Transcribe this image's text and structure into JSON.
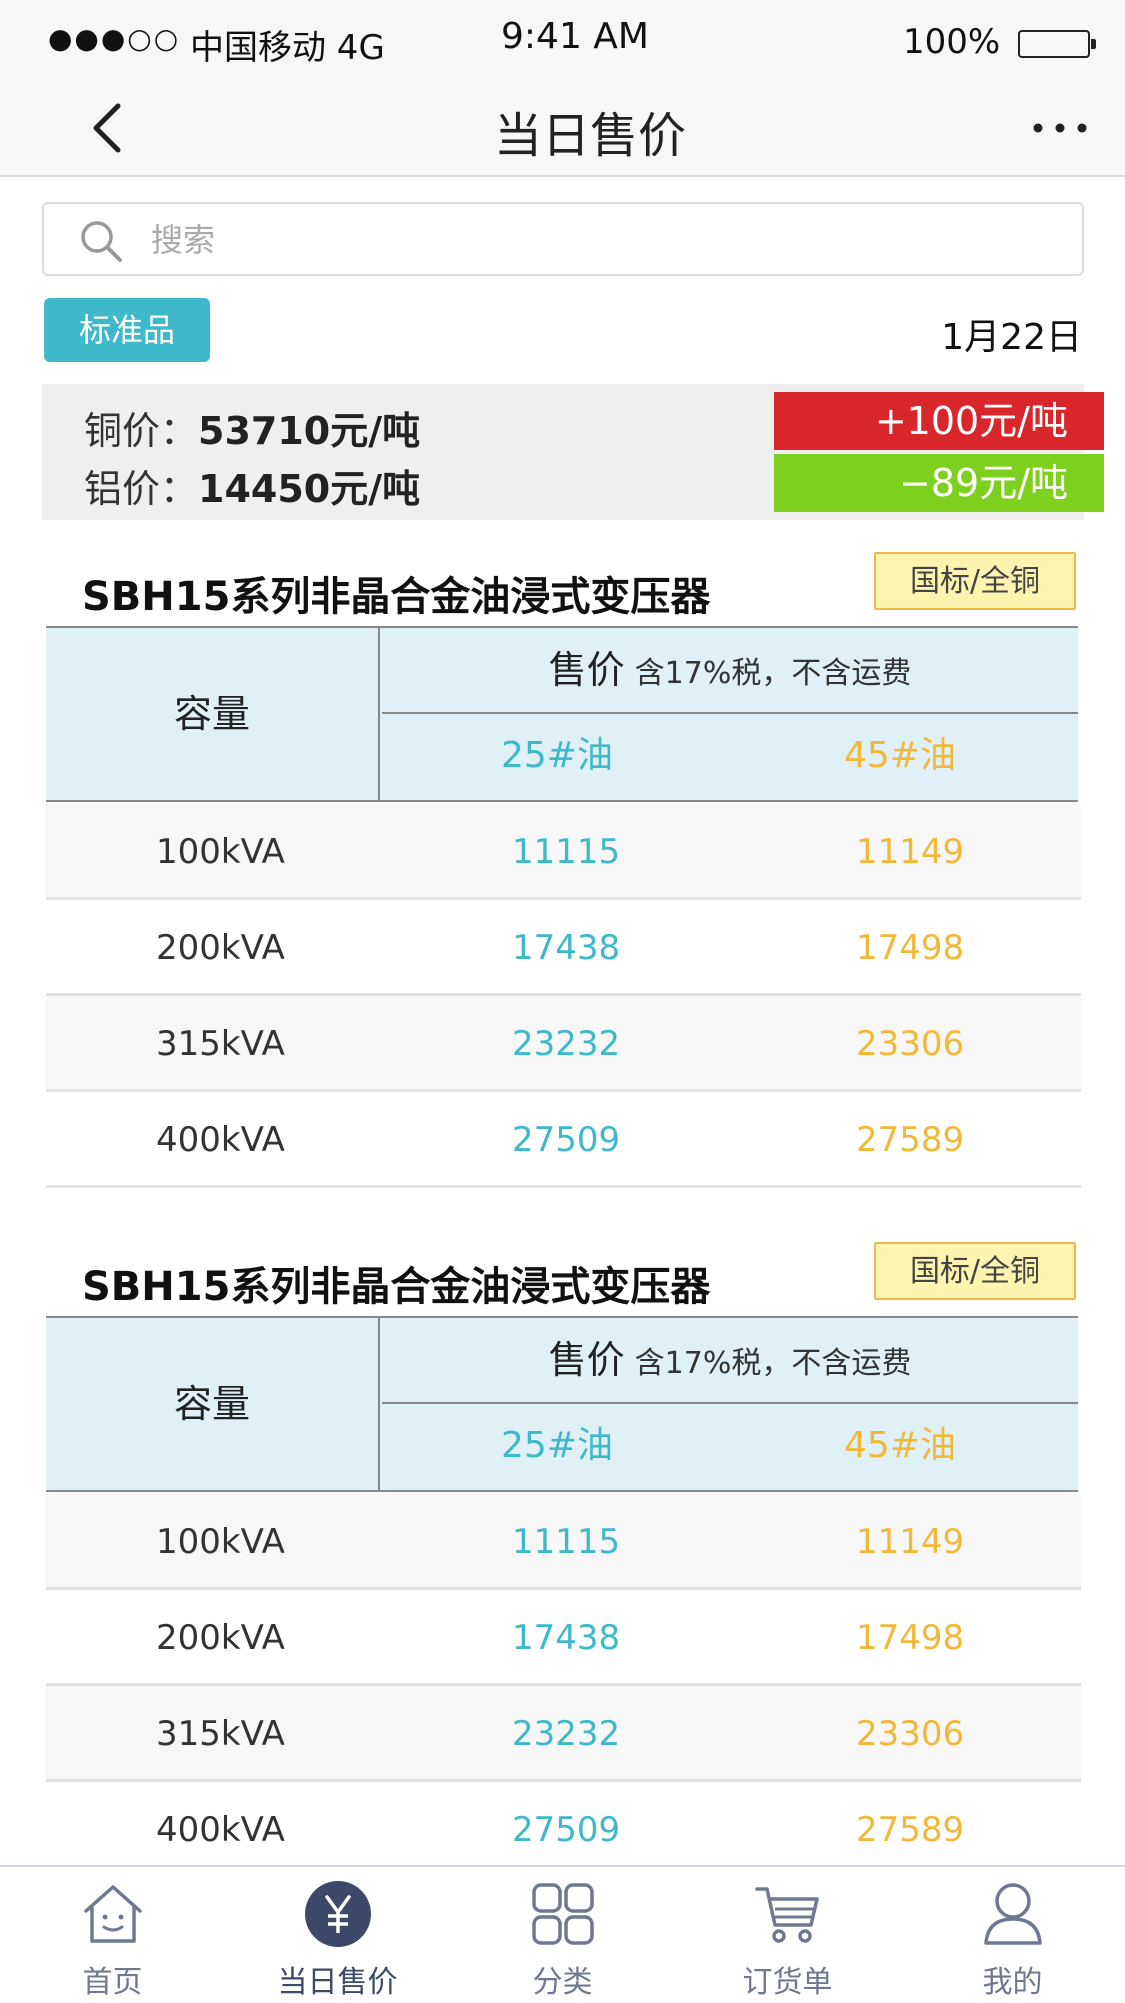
{
  "status_bar": {
    "signal": "●●●○○",
    "carrier": "中国移动 4G",
    "time": "9:41 AM",
    "battery": "100%"
  },
  "nav": {
    "title": "当日售价"
  },
  "search": {
    "placeholder": "搜索"
  },
  "category_tag": "标准品",
  "date": "1月22日",
  "metal_prices": {
    "copper_label": "铜价：",
    "copper_value": "53710元/吨",
    "copper_change": "+100元/吨",
    "aluminum_label": "铝价：",
    "aluminum_value": "14450元/吨",
    "aluminum_change": "−89元/吨",
    "up_color": "#d8262b",
    "down_color": "#7ed01e"
  },
  "products": [
    {
      "title": "SBH15系列非晶合金油浸式变压器",
      "badge": "国标/全铜",
      "capacity_header": "容量",
      "price_header": "售价",
      "price_note": "含17%税，不含运费",
      "oil25_header": "25#油",
      "oil45_header": "45#油",
      "rows": [
        {
          "capacity": "100kVA",
          "p25": "11115",
          "p45": "11149"
        },
        {
          "capacity": "200kVA",
          "p25": "17438",
          "p45": "17498"
        },
        {
          "capacity": "315kVA",
          "p25": "23232",
          "p45": "23306"
        },
        {
          "capacity": "400kVA",
          "p25": "27509",
          "p45": "27589"
        }
      ]
    },
    {
      "title": "SBH15系列非晶合金油浸式变压器",
      "badge": "国标/全铜",
      "capacity_header": "容量",
      "price_header": "售价",
      "price_note": "含17%税，不含运费",
      "oil25_header": "25#油",
      "oil45_header": "45#油",
      "rows": [
        {
          "capacity": "100kVA",
          "p25": "11115",
          "p45": "11149"
        },
        {
          "capacity": "200kVA",
          "p25": "17438",
          "p45": "17498"
        },
        {
          "capacity": "315kVA",
          "p25": "23232",
          "p45": "23306"
        },
        {
          "capacity": "400kVA",
          "p25": "27509",
          "p45": "27589"
        }
      ]
    }
  ],
  "tabs": [
    {
      "label": "首页",
      "icon": "home-icon"
    },
    {
      "label": "当日售价",
      "icon": "yuan-icon",
      "active": true
    },
    {
      "label": "分类",
      "icon": "grid-icon"
    },
    {
      "label": "订货单",
      "icon": "cart-icon"
    },
    {
      "label": "我的",
      "icon": "user-icon"
    }
  ],
  "colors": {
    "accent_teal": "#3fb8c9",
    "accent_orange": "#f2b83a",
    "tab_active": "#3d4968"
  }
}
